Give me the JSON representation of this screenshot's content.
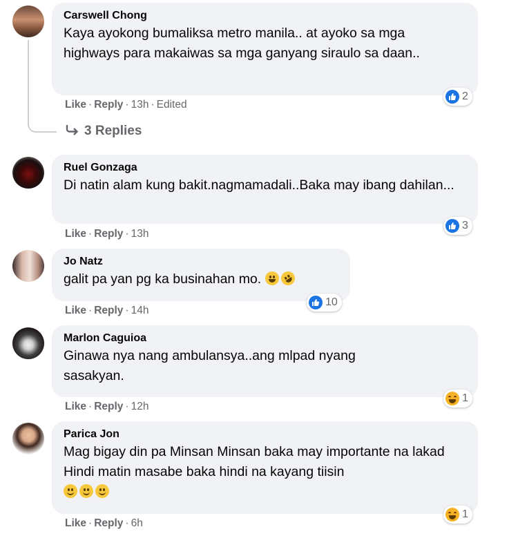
{
  "actions": {
    "like": "Like",
    "reply": "Reply",
    "separator": "·"
  },
  "comments": [
    {
      "author": "Carswell Chong",
      "text": "Kaya ayokong bumaliksa metro manila.. at ayoko sa mga highways para makaiwas sa mga ganyang siraulo sa daan..",
      "time": "13h",
      "edited": "Edited",
      "reaction": {
        "type": "like",
        "count": "2"
      },
      "replies_label": "3 Replies"
    },
    {
      "author": "Ruel Gonzaga",
      "text": "Di natin alam kung bakit.nagmamadali..Baka may ibang dahilan...",
      "time": "13h",
      "reaction": {
        "type": "like",
        "count": "3"
      }
    },
    {
      "author": "Jo Natz",
      "text": "galit pa yan pg ka businahan mo.",
      "time": "14h",
      "reaction": {
        "type": "like",
        "count": "10"
      }
    },
    {
      "author": "Marlon Caguioa",
      "text": "Ginawa nya nang ambulansya..ang mlpad nyang sasakyan.",
      "time": "12h",
      "reaction": {
        "type": "haha",
        "count": "1"
      }
    },
    {
      "author": "Parica Jon",
      "text": "Mag bigay din pa Minsan Minsan baka may importante na lakad Hindi matin masabe baka hindi na kayang tiisin",
      "time": "6h",
      "reaction": {
        "type": "haha",
        "count": "1"
      }
    }
  ],
  "colors": {
    "bubble": "#f0f2f5",
    "meta": "#65676b",
    "like_blue": "#1b74e4",
    "haha_yellow": "#f7b125"
  }
}
